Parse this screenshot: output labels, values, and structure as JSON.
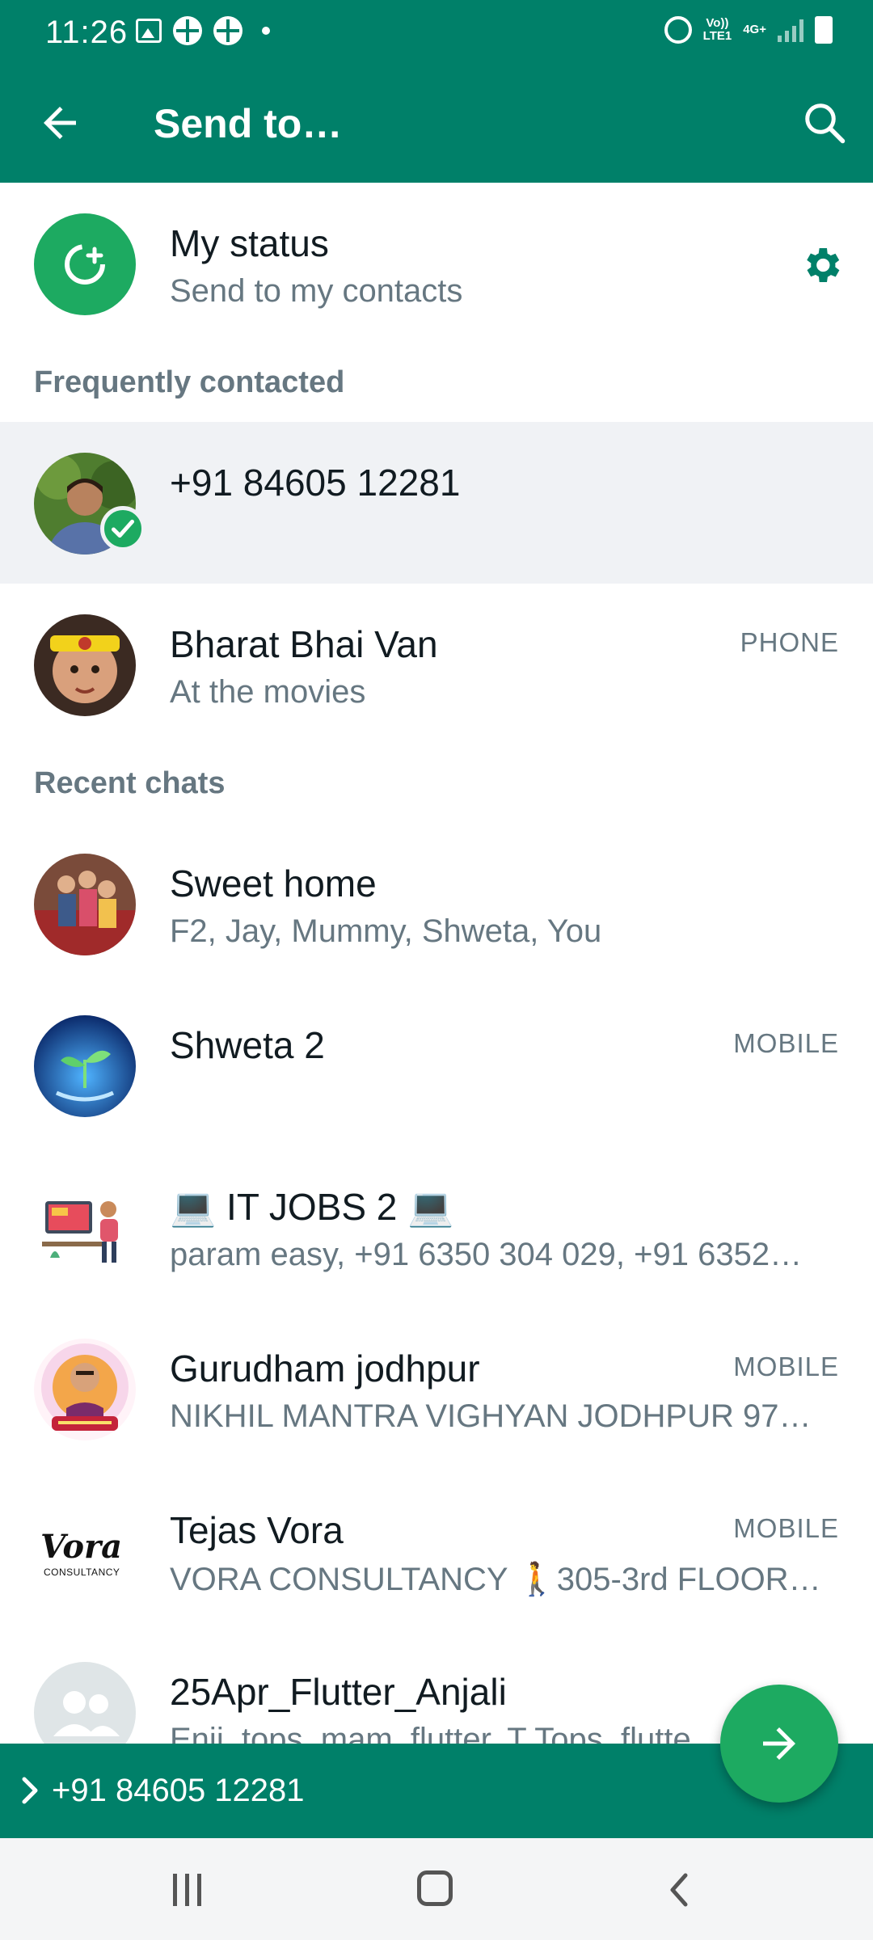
{
  "status_bar": {
    "time": "11:26",
    "network_label_top": "Vo))",
    "network_label_bottom": "LTE1",
    "data_label": "4G+"
  },
  "app_bar": {
    "title": "Send to…"
  },
  "my_status": {
    "title": "My status",
    "subtitle": "Send to my contacts"
  },
  "sections": {
    "frequent": "Frequently contacted",
    "recent": "Recent chats"
  },
  "frequent": [
    {
      "name": "+91 84605 12281",
      "subtitle": "",
      "tag": "",
      "selected": true
    },
    {
      "name": "Bharat Bhai Van",
      "subtitle": "At the movies",
      "tag": "PHONE",
      "selected": false
    }
  ],
  "recent": [
    {
      "name": "Sweet home",
      "subtitle": "F2, Jay, Mummy, Shweta, You",
      "tag": ""
    },
    {
      "name": "Shweta 2",
      "subtitle": "",
      "tag": "MOBILE"
    },
    {
      "name": "💻 IT JOBS 2 💻",
      "subtitle": "param easy, +91 6350 304 029, +91 6352…",
      "tag": ""
    },
    {
      "name": "Gurudham jodhpur",
      "subtitle": "NIKHIL MANTRA VIGHYAN JODHPUR 97…",
      "tag": "MOBILE"
    },
    {
      "name": "Tejas Vora",
      "subtitle": "VORA CONSULTANCY  🚶305-3rd FLOOR…",
      "tag": "MOBILE"
    },
    {
      "name": "25Apr_Flutter_Anjali",
      "subtitle": "Enji, tops, mam, flutter, T Tops, flutte…",
      "tag": ""
    }
  ],
  "avatar_texts": {
    "vora_logo": "Vora",
    "vora_logo_sub": "CONSULTANCY"
  },
  "selection_bar": {
    "text": "+91 84605 12281"
  },
  "colors": {
    "primary": "#008069",
    "accent": "#1daa61",
    "selected_bg": "#f0f2f5"
  }
}
